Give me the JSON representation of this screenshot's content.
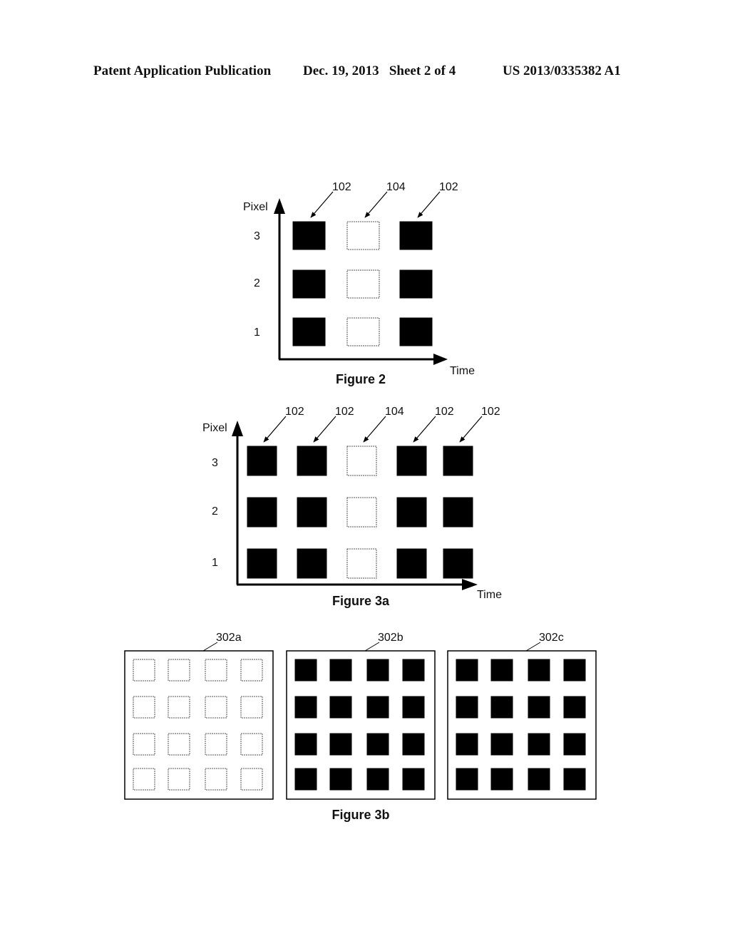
{
  "header": {
    "left": "Patent Application Publication",
    "date_sheet": "Dec. 19, 2013   Sheet 2 of 4",
    "number": "US 2013/0335382 A1"
  },
  "figure2": {
    "caption": "Figure 2",
    "y_axis_label": "Pixel",
    "x_axis_label": "Time",
    "rows": [
      "3",
      "2",
      "1"
    ],
    "columns": [
      {
        "ref": "102",
        "filled": true
      },
      {
        "ref": "104",
        "filled": false
      },
      {
        "ref": "102",
        "filled": true
      }
    ]
  },
  "figure3a": {
    "caption": "Figure 3a",
    "y_axis_label": "Pixel",
    "x_axis_label": "Time",
    "rows": [
      "3",
      "2",
      "1"
    ],
    "columns": [
      {
        "ref": "102",
        "filled": true
      },
      {
        "ref": "102",
        "filled": true
      },
      {
        "ref": "104",
        "filled": false
      },
      {
        "ref": "102",
        "filled": true
      },
      {
        "ref": "102",
        "filled": true
      }
    ]
  },
  "figure3b": {
    "caption": "Figure 3b",
    "panels": [
      {
        "ref": "302a",
        "filled": false,
        "grid": [
          4,
          4
        ]
      },
      {
        "ref": "302b",
        "filled": true,
        "grid": [
          4,
          4
        ]
      },
      {
        "ref": "302c",
        "filled": true,
        "grid": [
          4,
          4
        ]
      }
    ]
  }
}
